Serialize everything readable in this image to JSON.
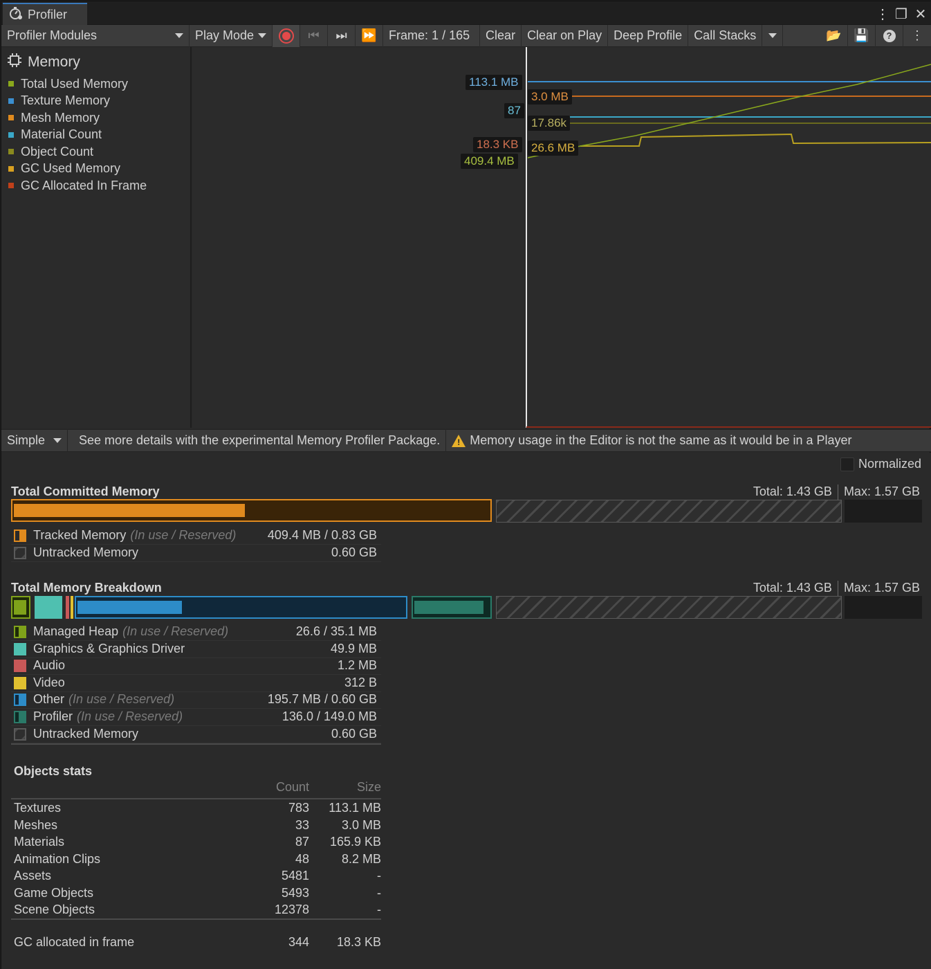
{
  "window": {
    "tab_title": "Profiler"
  },
  "toolbar": {
    "modules_label": "Profiler Modules",
    "play_mode_label": "Play Mode",
    "frame_label": "Frame: 1 / 165",
    "clear_label": "Clear",
    "clear_on_play_label": "Clear on Play",
    "deep_profile_label": "Deep Profile",
    "call_stacks_label": "Call Stacks"
  },
  "module": {
    "title": "Memory",
    "series": [
      {
        "label": "Total Used Memory",
        "color": "#8aa81c"
      },
      {
        "label": "Texture Memory",
        "color": "#3b8fd0"
      },
      {
        "label": "Mesh Memory",
        "color": "#e08a1e"
      },
      {
        "label": "Material Count",
        "color": "#3aa8c8"
      },
      {
        "label": "Object Count",
        "color": "#8a8a1e"
      },
      {
        "label": "GC Used Memory",
        "color": "#d8a020"
      },
      {
        "label": "GC Allocated In Frame",
        "color": "#c0401a"
      }
    ]
  },
  "chart_labels": {
    "texture": "113.1 MB",
    "mesh": "3.0 MB",
    "material": "87",
    "object": "17.86k",
    "gc_alloc": "18.3 KB",
    "gc_used": "26.6 MB",
    "total": "409.4 MB"
  },
  "detail_bar": {
    "view_mode": "Simple",
    "package_hint": "See more details with the experimental Memory Profiler Package.",
    "warning": "Memory usage in the Editor is not the same as it would be in a Player"
  },
  "normalized_label": "Normalized",
  "committed": {
    "title": "Total Committed Memory",
    "total": "Total: 1.43 GB",
    "max": "Max: 1.57 GB",
    "rows": [
      {
        "name": "Tracked Memory",
        "sub": "(In use / Reserved)",
        "value": "409.4 MB / 0.83 GB",
        "color": "#e08a1e"
      },
      {
        "name": "Untracked Memory",
        "sub": "",
        "value": "0.60 GB",
        "color": "#3a3a3a"
      }
    ]
  },
  "breakdown": {
    "title": "Total Memory Breakdown",
    "total": "Total: 1.43 GB",
    "max": "Max: 1.57 GB",
    "rows": [
      {
        "name": "Managed Heap",
        "sub": "(In use / Reserved)",
        "value": "26.6 / 35.1 MB",
        "color": "#7fa21a"
      },
      {
        "name": "Graphics & Graphics Driver",
        "sub": "",
        "value": "49.9 MB",
        "color": "#4fc0b0"
      },
      {
        "name": "Audio",
        "sub": "",
        "value": "1.2 MB",
        "color": "#c85858"
      },
      {
        "name": "Video",
        "sub": "",
        "value": "312 B",
        "color": "#e0c030"
      },
      {
        "name": "Other",
        "sub": "(In use / Reserved)",
        "value": "195.7 MB / 0.60 GB",
        "color": "#2d8cc8"
      },
      {
        "name": "Profiler",
        "sub": "(In use / Reserved)",
        "value": "136.0 / 149.0 MB",
        "color": "#2a7a68"
      },
      {
        "name": "Untracked Memory",
        "sub": "",
        "value": "0.60 GB",
        "color": "#3a3a3a"
      }
    ]
  },
  "objects": {
    "title": "Objects stats",
    "col_count": "Count",
    "col_size": "Size",
    "rows": [
      {
        "name": "Textures",
        "count": "783",
        "size": "113.1 MB"
      },
      {
        "name": "Meshes",
        "count": "33",
        "size": "3.0 MB"
      },
      {
        "name": "Materials",
        "count": "87",
        "size": "165.9 KB"
      },
      {
        "name": "Animation Clips",
        "count": "48",
        "size": "8.2 MB"
      },
      {
        "name": "Assets",
        "count": "5481",
        "size": "-"
      },
      {
        "name": "Game Objects",
        "count": "5493",
        "size": "-"
      },
      {
        "name": "Scene Objects",
        "count": "12378",
        "size": "-"
      }
    ],
    "gc": {
      "name": "GC allocated in frame",
      "count": "344",
      "size": "18.3 KB"
    }
  }
}
